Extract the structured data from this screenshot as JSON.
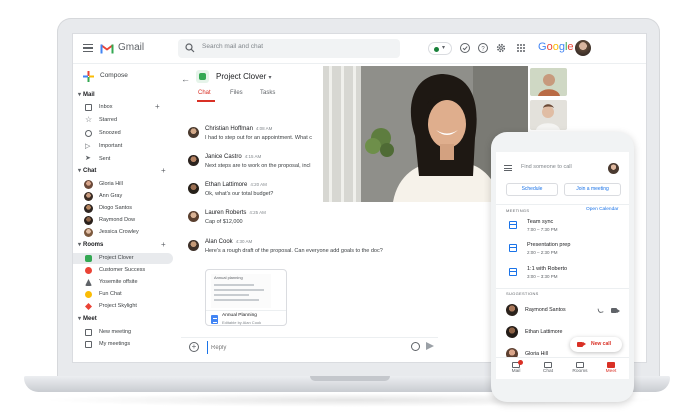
{
  "gmail": {
    "brand": "Gmail",
    "search_placeholder": "Search mail and chat",
    "compose_label": "Compose",
    "google_letters": [
      "G",
      "o",
      "o",
      "g",
      "l",
      "e"
    ],
    "sections": {
      "mail": "Mail",
      "chat": "Chat",
      "rooms": "Rooms",
      "meet": "Meet"
    },
    "mail_items": [
      "Inbox",
      "Starred",
      "Snoozed",
      "Important",
      "Sent"
    ],
    "chat_items": [
      "Gloria Hill",
      "Ann Gray",
      "Diogo Santos",
      "Raymond Dow",
      "Jessica Crowley"
    ],
    "room_items": [
      "Project Clover",
      "Customer Success",
      "Yosemite offsite",
      "Fun Chat",
      "Project Skylight"
    ],
    "meet_items": [
      "New meeting",
      "My meetings"
    ]
  },
  "chat": {
    "room_title": "Project Clover",
    "tabs": [
      "Chat",
      "Files",
      "Tasks"
    ],
    "messages": [
      {
        "name": "Christian Hoffman",
        "time": "4:08 AM",
        "text": "I had to step out for an appointment. What c"
      },
      {
        "name": "Janice Castro",
        "time": "4:15 AM",
        "text": "Next steps are to work on the proposal, incl"
      },
      {
        "name": "Ethan Lattimore",
        "time": "4:20 AM",
        "text": "Ok, what's our total budget?"
      },
      {
        "name": "Lauren Roberts",
        "time": "4:25 AM",
        "text": "Cap of $12,000"
      },
      {
        "name": "Alan Cook",
        "time": "4:30 AM",
        "text": "Here's a rough draft of the proposal. Can everyone add goals to the doc?"
      }
    ],
    "attachment": {
      "preview_title": "Annual planning",
      "name": "Annual Planning",
      "sub": "Editable by Alan Cook"
    },
    "reply_placeholder": "Reply"
  },
  "phone": {
    "search_placeholder": "Find someone to call",
    "schedule_label": "Schedule",
    "join_label": "Join a meeting",
    "meetings_heading": "MEETINGS",
    "open_calendar": "Open Calendar",
    "meetings": [
      {
        "title": "Team sync",
        "time": "7:00 – 7:30 PM"
      },
      {
        "title": "Presentation prep",
        "time": "2:00 – 2:30 PM"
      },
      {
        "title": "1:1 with Roberto",
        "time": "3:00 – 3:30 PM"
      }
    ],
    "suggestions_heading": "SUGGESTIONS",
    "suggestions": [
      "Raymond Santos",
      "Ethan Lattimore",
      "Gloria Hill"
    ],
    "new_call_label": "New call",
    "nav": [
      "Mail",
      "Chat",
      "Rooms",
      "Meet"
    ]
  },
  "colors": {
    "accent_red": "#d93025",
    "link_blue": "#1a73e8",
    "room_green": "#34a853"
  }
}
